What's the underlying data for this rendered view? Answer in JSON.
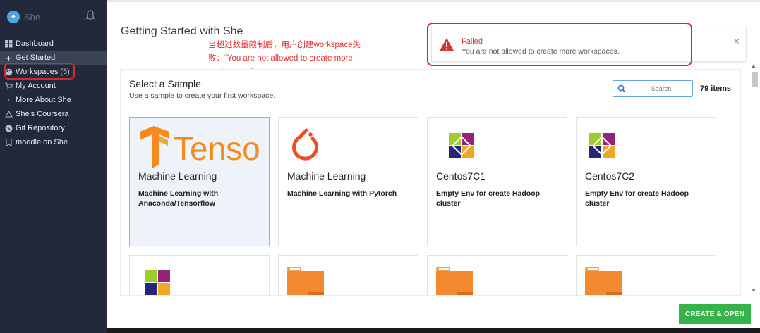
{
  "sidebar": {
    "logo_text": "She",
    "items": [
      {
        "icon": "grid-icon",
        "label": "Dashboard"
      },
      {
        "icon": "plus-icon",
        "label": "Get Started"
      },
      {
        "icon": "palette-icon",
        "label": "Workspaces",
        "count": "(5)"
      },
      {
        "icon": "cart-icon",
        "label": "My Account"
      },
      {
        "icon": "chevron-right-icon",
        "label": "More About She"
      },
      {
        "icon": "triangle-icon",
        "label": "She's Coursera"
      },
      {
        "icon": "git-icon",
        "label": "Git Repository"
      },
      {
        "icon": "bookmark-icon",
        "label": "moodle on She"
      }
    ]
  },
  "main": {
    "page_title": "Getting Started with She",
    "annotation_line1": "当超过数量限制后，用户创建workspace失",
    "annotation_line2": "败：“You are not allowed to create more",
    "annotation_line3": "workspaces”"
  },
  "toast": {
    "title": "Failed",
    "message": "You are not allowed to create more workspaces.",
    "close": "×"
  },
  "panel": {
    "title": "Select a Sample",
    "subtitle": "Use a sample to create your first workspace.",
    "search_placeholder": "Search",
    "item_count": "79 items",
    "cards": [
      {
        "title": "Machine Learning",
        "desc": "Machine Learning with Anaconda/Tensorflow",
        "thumb": "tensorflow-logo",
        "thumb_text": "Tensor"
      },
      {
        "title": "Machine Learning",
        "desc": "Machine Learning with Pytorch",
        "thumb": "pytorch-logo"
      },
      {
        "title": "Centos7C1",
        "desc": "Empty Env for create Hadoop cluster",
        "thumb": "centos-logo"
      },
      {
        "title": "Centos7C2",
        "desc": "Empty Env for create Hadoop cluster",
        "thumb": "centos-logo"
      }
    ]
  },
  "footer": {
    "create_label": "CREATE & OPEN"
  },
  "colors": {
    "sidebar_bg": "#21293a",
    "accent_green": "#36b34a",
    "error_red": "#d5352a",
    "annotation_red": "#e3302f"
  }
}
